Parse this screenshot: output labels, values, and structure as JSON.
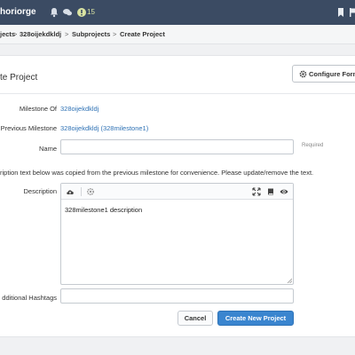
{
  "topbar": {
    "brand": "horiorge",
    "notification_count": "15"
  },
  "breadcrumb": {
    "items": [
      "jects",
      "328oijekdkldj",
      "Subprojects",
      "Create Project"
    ],
    "separator": ">"
  },
  "card": {
    "title": "te Project",
    "configure_button": "Configure Form"
  },
  "form": {
    "milestone_of": {
      "label": "Milestone Of",
      "value": "328oijekdkldj"
    },
    "previous_milestone": {
      "label": "Previous Milestone",
      "value": "328oijekdkldj (328milestone1)"
    },
    "name": {
      "label": "Name",
      "value": "",
      "required_text": "Required"
    },
    "notice": "ription text below was copied from the previous milestone for convenience. Please update/remove the text.",
    "description": {
      "label": "Description",
      "value": "328milestone1 description"
    },
    "hashtags": {
      "label": "dditional Hashtags",
      "value": ""
    },
    "cancel_label": "Cancel",
    "submit_label": "Create New Project"
  },
  "colors": {
    "topbar": "#3b4b63",
    "link": "#2f72b5",
    "primary_button": "#3a85cf"
  },
  "icons": [
    "bell-icon",
    "chat-icon",
    "alert-icon",
    "bookmark-icon",
    "flag-icon",
    "gear-icon",
    "cloud-upload-icon",
    "settings-icon",
    "expand-icon",
    "book-icon",
    "eye-icon"
  ]
}
